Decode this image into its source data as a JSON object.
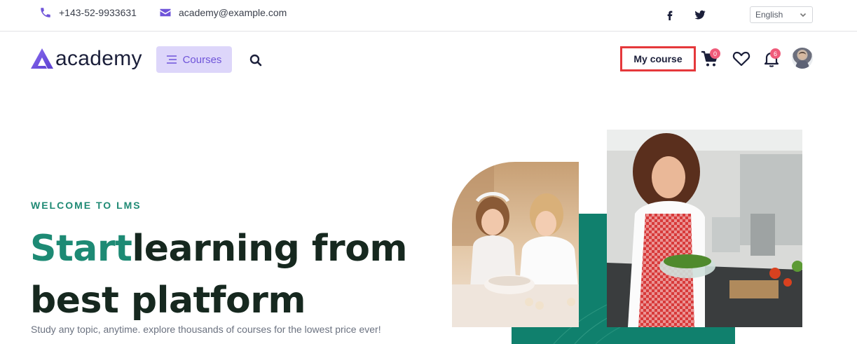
{
  "topbar": {
    "phone": "+143-52-9933631",
    "email": "academy@example.com",
    "social_icons": [
      "facebook-icon",
      "twitter-icon"
    ],
    "language": "English"
  },
  "header": {
    "logo_text": "academy",
    "courses_label": "Courses",
    "my_course_label": "My course",
    "cart_count": "0",
    "notification_count": "6"
  },
  "hero": {
    "eyebrow": "WELCOME TO LMS",
    "headline_accent": "Start",
    "headline_rest": "learning from best platform",
    "subtitle": "Study any topic, anytime. explore thousands of courses for the lowest price ever!"
  },
  "colors": {
    "brand_purple": "#6f54d9",
    "accent_green": "#1d8a74",
    "highlight_red": "#e5383b",
    "badge_pink": "#ef5b7a"
  }
}
